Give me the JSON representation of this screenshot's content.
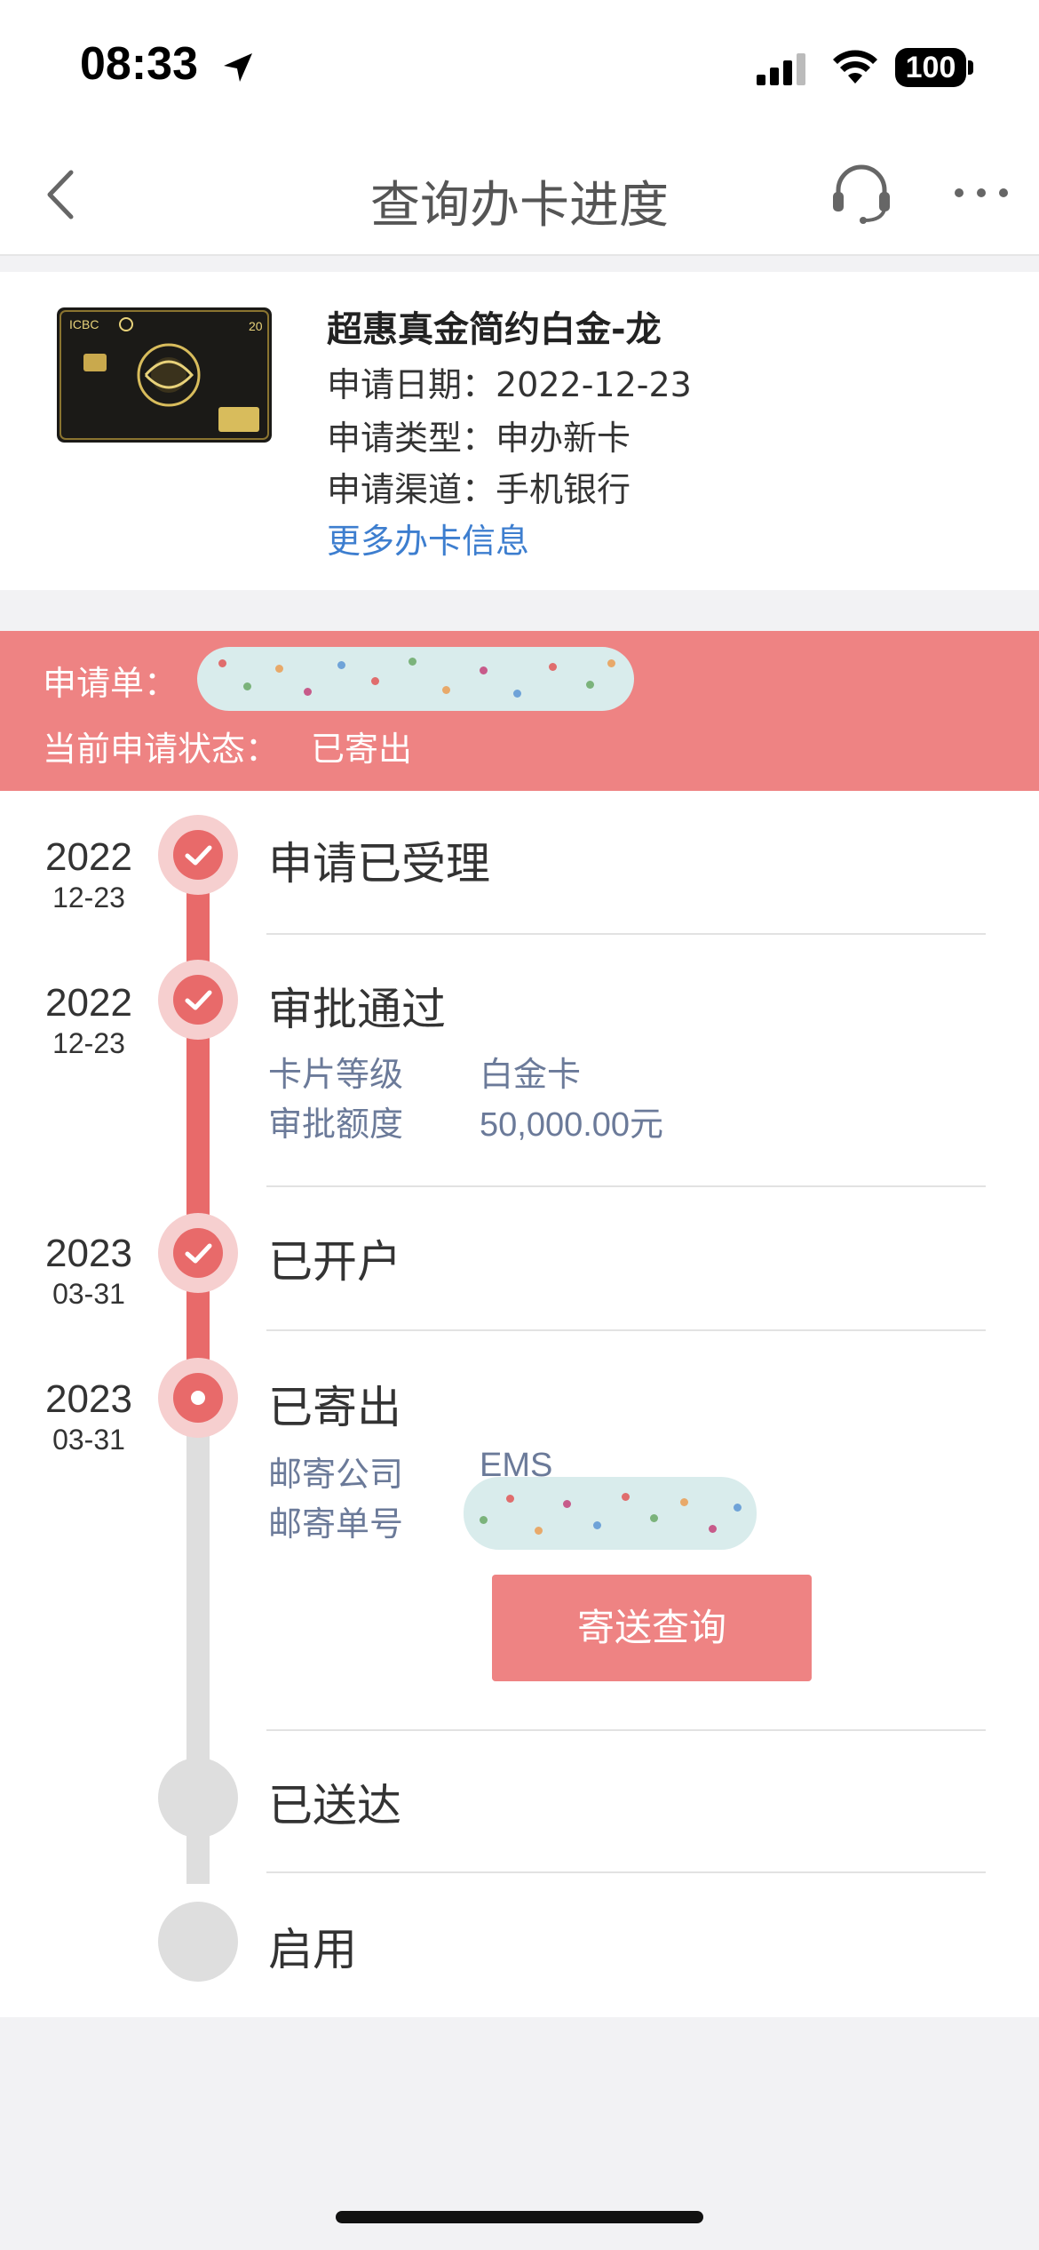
{
  "status_bar": {
    "time": "08:33",
    "battery": "100"
  },
  "nav": {
    "title": "查询办卡进度"
  },
  "card": {
    "name": "超惠真金简约白金-龙",
    "apply_date": "申请日期：2022-12-23",
    "apply_type": "申请类型：申办新卡",
    "apply_channel": "申请渠道：手机银行",
    "more_link": "更多办卡信息",
    "image_text": "ICBC"
  },
  "banner": {
    "order_label": "申请单：",
    "status_label": "当前申请状态：",
    "status_value": "已寄出"
  },
  "timeline": {
    "steps": [
      {
        "year": "2022",
        "day": "12-23",
        "title": "申请已受理",
        "state": "done"
      },
      {
        "year": "2022",
        "day": "12-23",
        "title": "审批通过",
        "state": "done",
        "details": [
          {
            "label": "卡片等级",
            "value": "白金卡"
          },
          {
            "label": "审批额度",
            "value": "50,000.00元"
          }
        ]
      },
      {
        "year": "2023",
        "day": "03-31",
        "title": "已开户",
        "state": "done"
      },
      {
        "year": "2023",
        "day": "03-31",
        "title": "已寄出",
        "state": "current",
        "details": [
          {
            "label": "邮寄公司",
            "value": "EMS"
          },
          {
            "label": "邮寄单号",
            "value": ""
          }
        ],
        "button": "寄送查询"
      },
      {
        "year": "",
        "day": "",
        "title": "已送达",
        "state": "pending"
      },
      {
        "year": "",
        "day": "",
        "title": "启用",
        "state": "pending"
      }
    ]
  },
  "colors": {
    "accent": "#ee8383",
    "node": "#e86a6a",
    "link": "#3d7ecf",
    "label": "#6b7a99"
  }
}
